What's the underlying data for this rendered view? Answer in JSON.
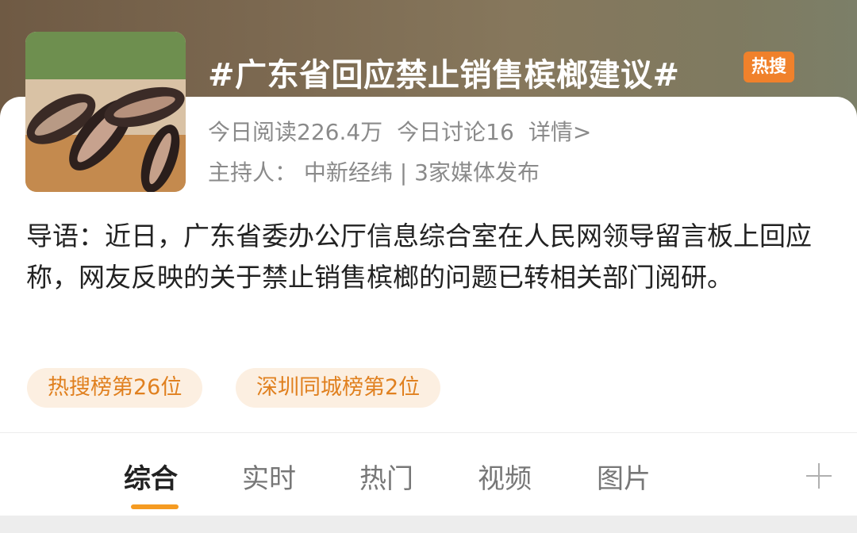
{
  "topic": {
    "title": "#广东省回应禁止销售槟榔建议#",
    "badge": "热搜",
    "stats": {
      "read": "今日阅读226.4万",
      "discuss": "今日讨论16",
      "details": "详情>"
    },
    "host": "主持人：  中新经纬 | 3家媒体发布",
    "intro": "导语：近日，广东省委办公厅信息综合室在人民网领导留言板上回应称，网友反映的关于禁止销售槟榔的问题已转相关部门阅研。",
    "chips": [
      "热搜榜第26位",
      "深圳同城榜第2位"
    ]
  },
  "tabs": [
    "综合",
    "实时",
    "热门",
    "视频",
    "图片"
  ],
  "icons": {
    "thumbnail": "betel-nut-image",
    "add": "plus-icon"
  },
  "colors": {
    "accent": "#f59b22",
    "badge": "#f0812b",
    "chip_text": "#e0801f"
  }
}
